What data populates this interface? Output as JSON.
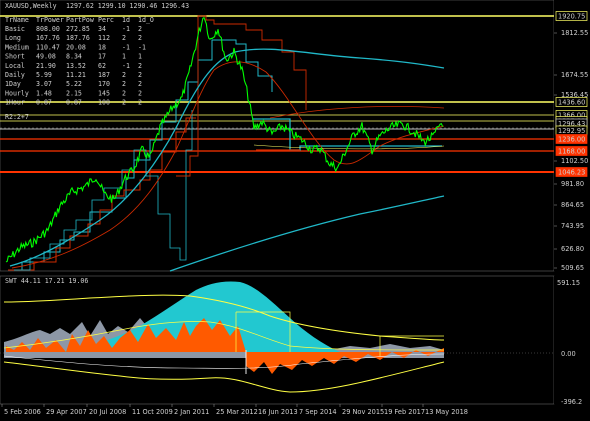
{
  "header": {
    "symbol": "XAUUSD,Weekly",
    "ohlc": "1297.62 1299.10 1290.46 1296.43",
    "indicator_title": "SWT 44.11 17.21 19.06",
    "level_tag": "R2:2+7"
  },
  "info_table": {
    "columns": [
      "TrName",
      "TrPower",
      "PartPow",
      "Perc",
      "1d",
      "1d_O"
    ],
    "rows": [
      [
        "Basic",
        "808.00",
        "272.85",
        "34",
        "-1",
        "2"
      ],
      [
        "Long",
        "167.76",
        "187.76",
        "112",
        "2",
        "2"
      ],
      [
        "Medium",
        "110.47",
        "20.08",
        "18",
        "-1",
        "-1"
      ],
      [
        "Short",
        "49.08",
        "8.34",
        "17",
        "1",
        "1"
      ],
      [
        "Local",
        "21.90",
        "13.52",
        "62",
        "-1",
        "2"
      ],
      [
        "Daily",
        "5.99",
        "11.21",
        "187",
        "2",
        "2"
      ],
      [
        "1Day",
        "3.07",
        "5.22",
        "170",
        "2",
        "2"
      ],
      [
        "Hourly",
        "1.48",
        "2.15",
        "145",
        "2",
        "2"
      ],
      [
        "1Hour",
        "0.87",
        "0.87",
        "100",
        "2",
        "2"
      ]
    ]
  },
  "price_axis": {
    "ticks": [
      "1812.55",
      "1674.55",
      "1536.45",
      "1102.50",
      "981.80",
      "864.65",
      "743.95",
      "626.80",
      "509.65"
    ],
    "labels": [
      {
        "text": "1920.75",
        "color": "#ffffff",
        "bg": "#000000",
        "border": "#ffff66"
      },
      {
        "text": "1436.60",
        "color": "#ffffff",
        "bg": "#000000",
        "border": "#ffff66"
      },
      {
        "text": "1366.00",
        "color": "#ffffff",
        "bg": "#000000",
        "border": "#ffff66"
      },
      {
        "text": "1335.82",
        "color": "#ffffff",
        "bg": "#000000",
        "border": "#ffff66"
      },
      {
        "text": "1296.43",
        "color": "#ffffff",
        "bg": "#000000",
        "border": "#cccccc"
      },
      {
        "text": "1292.95",
        "color": "#ffffff",
        "bg": "#000000",
        "border": "#ffff66"
      },
      {
        "text": "1236.00",
        "color": "#ffffff",
        "bg": "#ff3300",
        "border": "#ff3300"
      },
      {
        "text": "1168.00",
        "color": "#ffffff",
        "bg": "#ff3300",
        "border": "#ff3300"
      },
      {
        "text": "1046.23",
        "color": "#ffffff",
        "bg": "#ff3300",
        "border": "#ff3300"
      }
    ]
  },
  "indicator_axis": {
    "ticks": [
      "591.15",
      "0.00",
      "-396.2"
    ]
  },
  "time_axis": {
    "labels": [
      "5 Feb 2006",
      "29 Apr 2007",
      "20 Jul 2008",
      "11 Oct 2009",
      "2 Jan 2011",
      "25 Mar 2012",
      "16 Jun 2013",
      "7 Sep 2014",
      "29 Nov 2015",
      "19 Feb 2017",
      "13 May 2018"
    ]
  },
  "colors": {
    "price": "#00ff00",
    "ma_blue": "#20b8c8",
    "ma_red": "#cc2a00",
    "support": "#ff4400",
    "resistance": "#ffff66",
    "swt_fill": "#22c8d0",
    "swt_orange": "#ff5a00",
    "swt_gray": "#8d97a6"
  }
}
